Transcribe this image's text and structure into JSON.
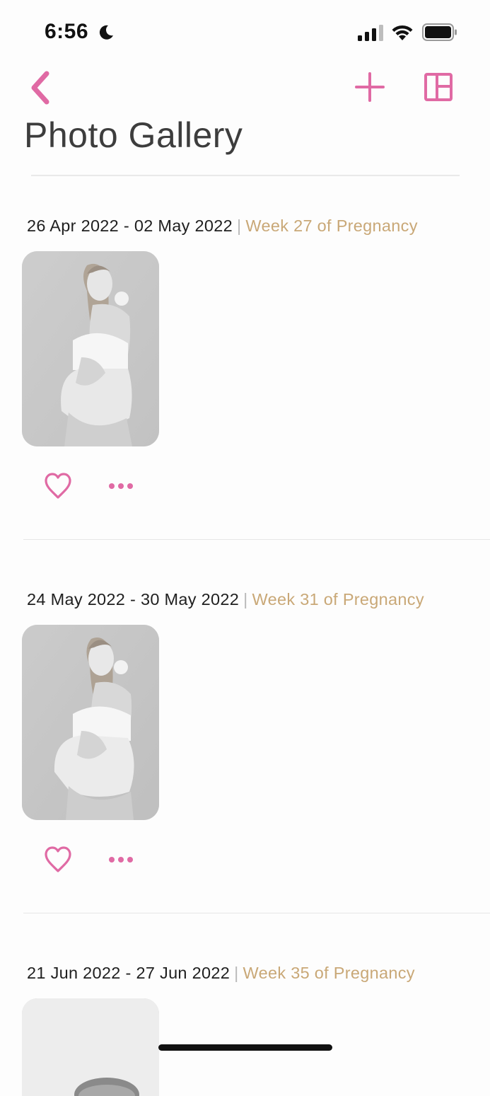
{
  "status_bar": {
    "time": "6:56"
  },
  "header": {
    "title": "Photo Gallery",
    "accent_color": "#e06aa4"
  },
  "sections": [
    {
      "date_range": "26 Apr 2022 - 02 May 2022",
      "separator": "|",
      "week_label": "Week 27 of Pregnancy"
    },
    {
      "date_range": "24 May 2022 - 30 May 2022",
      "separator": "|",
      "week_label": "Week 31 of Pregnancy"
    },
    {
      "date_range": "21 Jun 2022 - 27 Jun 2022",
      "separator": "|",
      "week_label": "Week 35 of Pregnancy"
    }
  ],
  "icons": {
    "back": "chevron-left-icon",
    "add": "plus-icon",
    "layout": "grid-layout-icon",
    "favorite": "heart-outline-icon",
    "more": "ellipsis-icon"
  },
  "colors": {
    "accent": "#e06aa4",
    "week_text": "#c9a877",
    "title_text": "#3d3d3d"
  }
}
